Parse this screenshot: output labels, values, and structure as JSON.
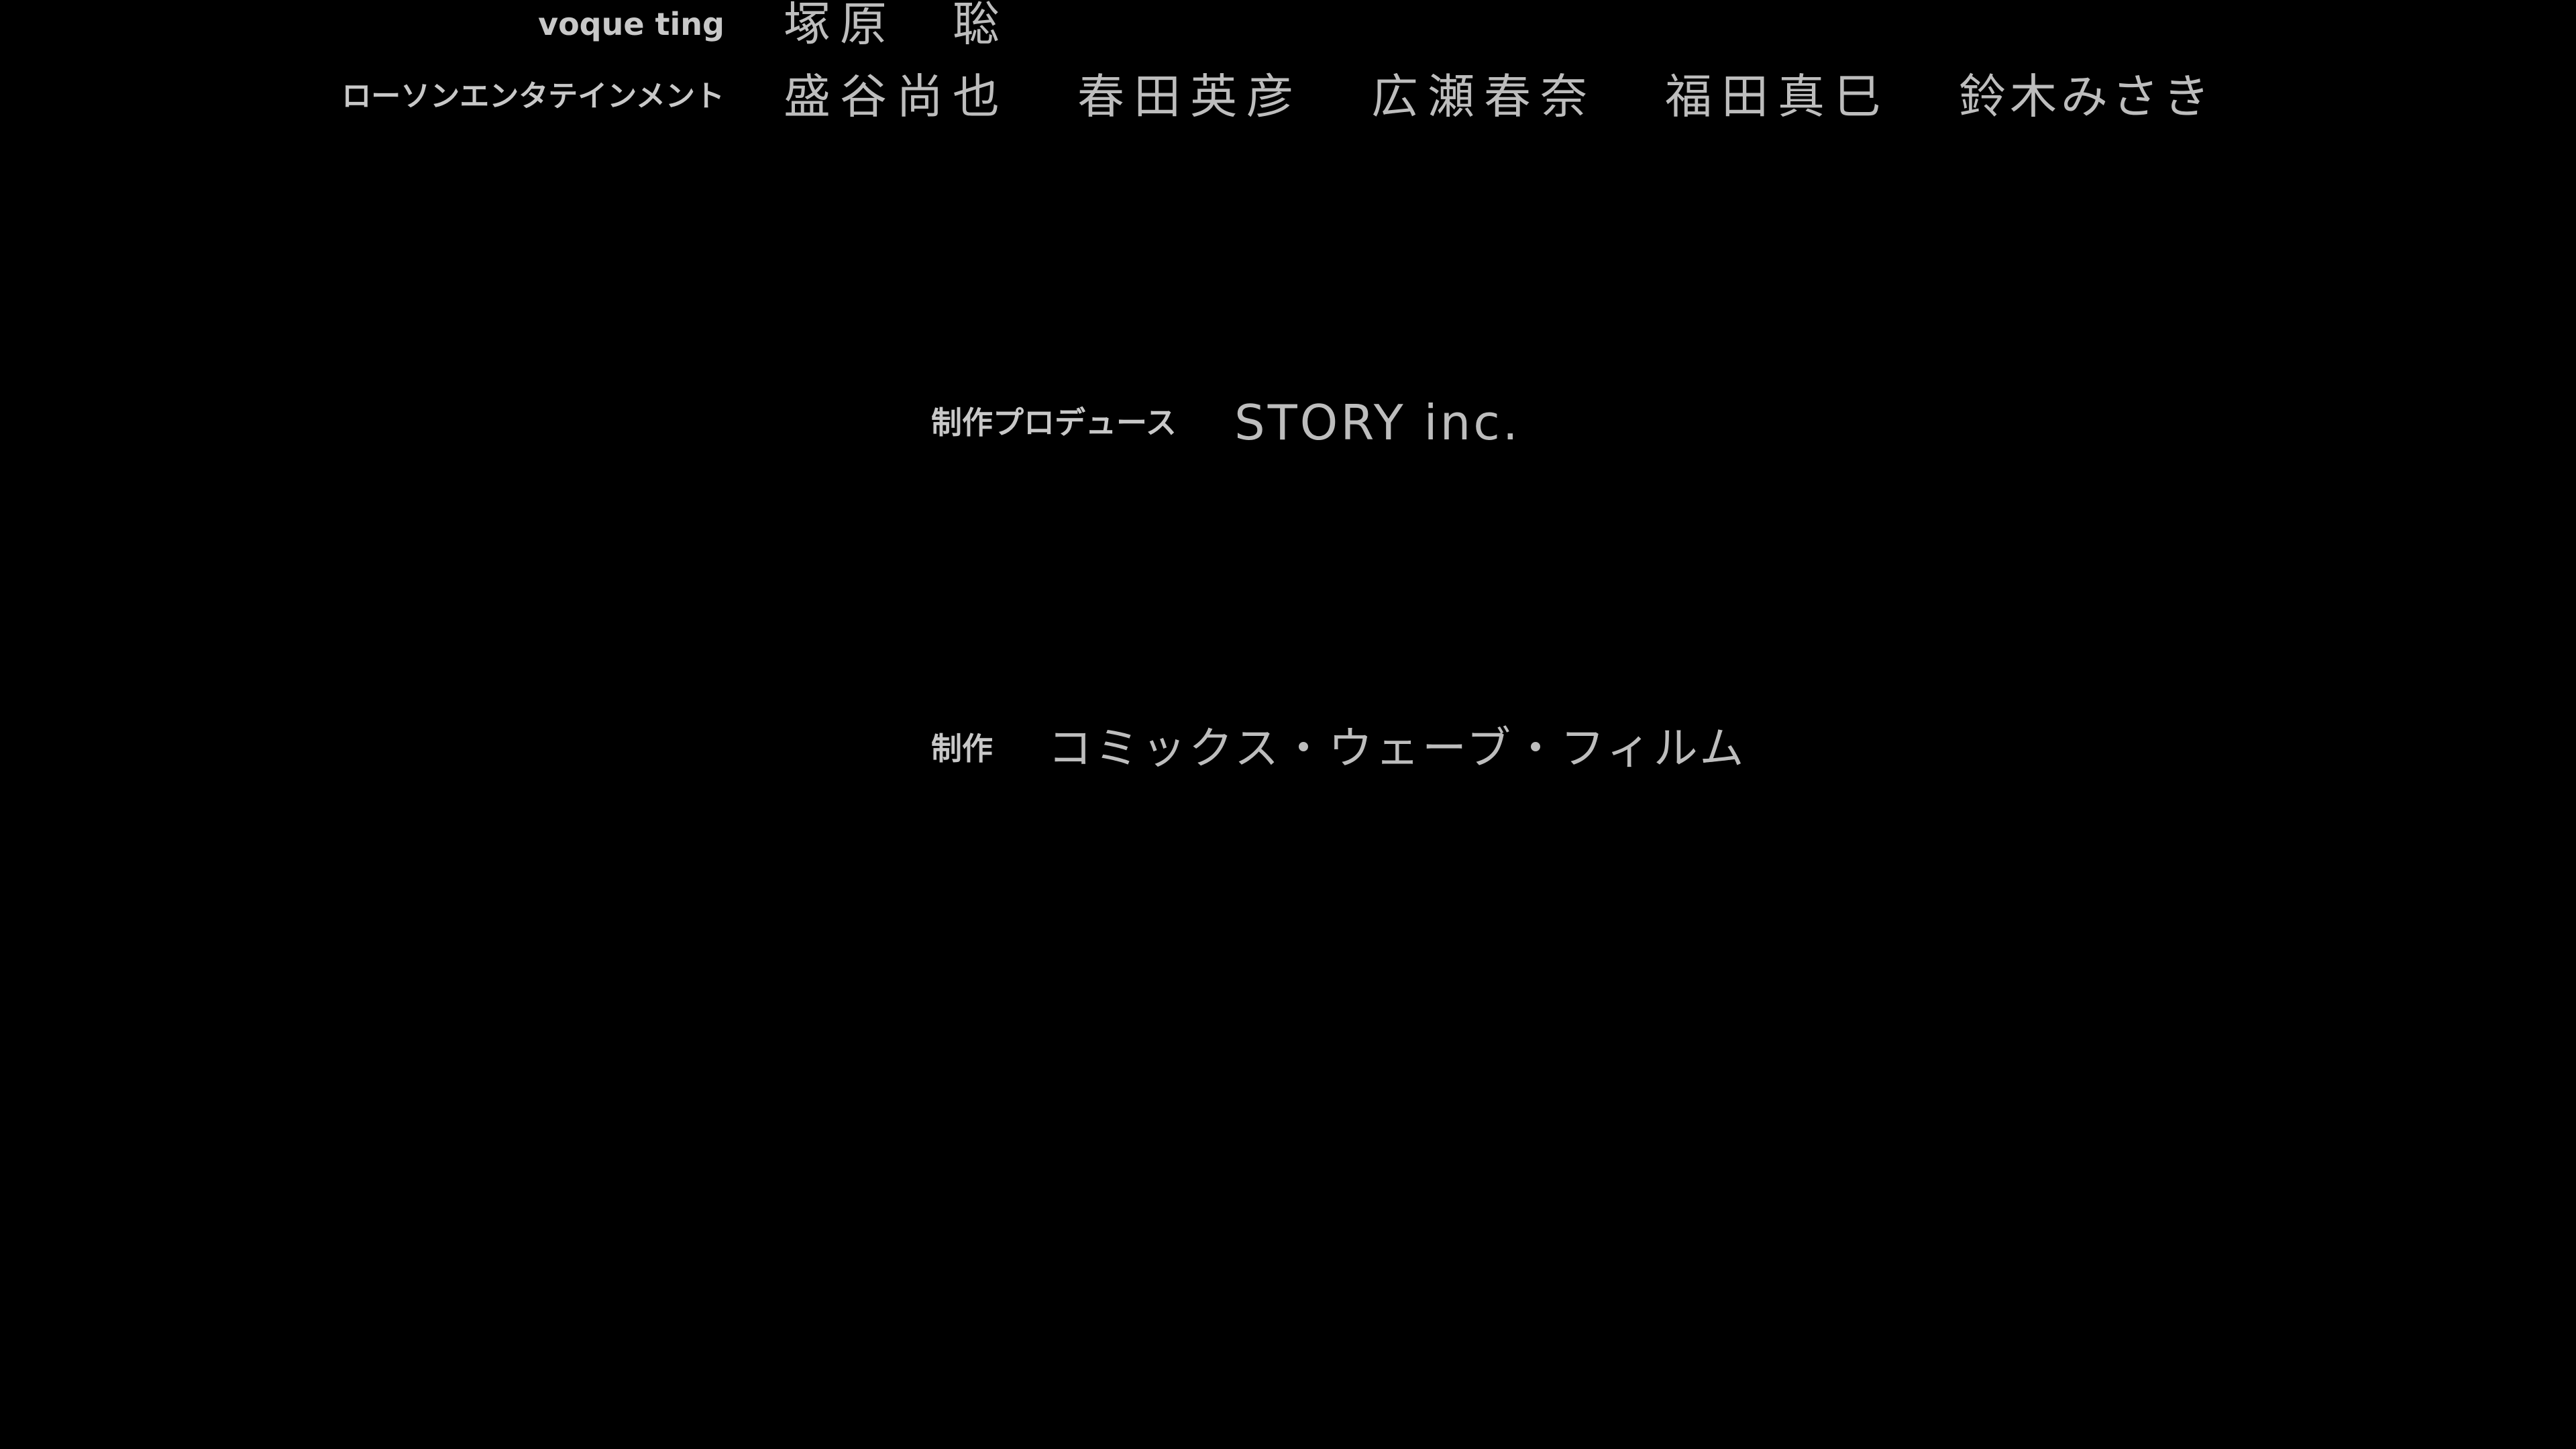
{
  "credits": {
    "voqueting": {
      "role": "voque ting",
      "names": [
        "塚原　聡"
      ]
    },
    "lawson": {
      "role": "ローソンエンタテインメント",
      "names": [
        "盛谷尚也",
        "春田英彦",
        "広瀬春奈",
        "福田真巳",
        "鈴木みさき"
      ]
    },
    "production_producer": {
      "role": "制作プロデュース",
      "name": "STORY inc."
    },
    "production": {
      "role": "制作",
      "name": "コミックス・ウェーブ・フィルム"
    }
  },
  "colors": {
    "background": "#000000",
    "role_text": "#c8c8c8",
    "name_text": "#bdbdbd"
  }
}
